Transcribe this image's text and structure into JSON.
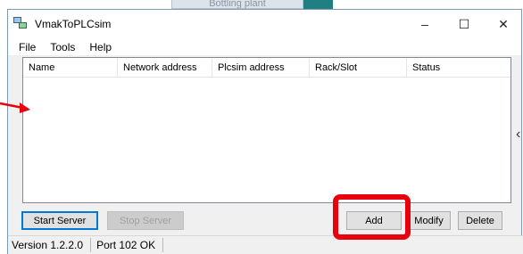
{
  "background": {
    "tab_label": "Bottling plant"
  },
  "window": {
    "title": "VmakToPLCsim",
    "controls": {
      "minimize": "–",
      "maximize": "☐",
      "close": "✕"
    }
  },
  "menu": {
    "items": [
      {
        "label": "File"
      },
      {
        "label": "Tools"
      },
      {
        "label": "Help"
      }
    ]
  },
  "table": {
    "columns": [
      {
        "label": "Name"
      },
      {
        "label": "Network address"
      },
      {
        "label": "Plcsim address"
      },
      {
        "label": "Rack/Slot"
      },
      {
        "label": "Status"
      }
    ],
    "rows": []
  },
  "buttons": {
    "start_server": "Start Server",
    "stop_server": "Stop Server",
    "add": "Add",
    "modify": "Modify",
    "delete": "Delete"
  },
  "status": {
    "version": "Version 1.2.2.0",
    "port": "Port 102 OK"
  },
  "colors": {
    "highlight": "#e8000d",
    "accent": "#0078d7",
    "annotation_arrow": "#e8000d"
  },
  "annotations": {
    "arrow_icon": "right-arrow-icon",
    "highlight": "add-button-highlight"
  }
}
